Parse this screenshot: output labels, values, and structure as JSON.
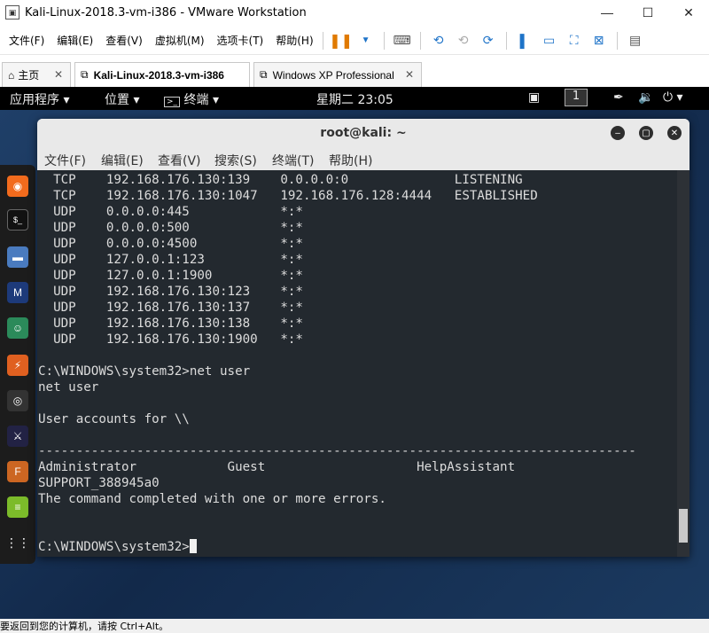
{
  "window": {
    "title": "Kali-Linux-2018.3-vm-i386 - VMware Workstation"
  },
  "menu": [
    "文件(F)",
    "编辑(E)",
    "查看(V)",
    "虚拟机(M)",
    "选项卡(T)",
    "帮助(H)"
  ],
  "tabs": [
    {
      "label": "主页"
    },
    {
      "label": "Kali-Linux-2018.3-vm-i386"
    },
    {
      "label": "Windows XP Professional"
    }
  ],
  "gnome": {
    "apps": "应用程序",
    "places": "位置",
    "terminal": "终端",
    "clock": "星期二 23:05",
    "workspace": "1"
  },
  "terminal": {
    "title": "root@kali: ~",
    "menu": [
      "文件(F)",
      "编辑(E)",
      "查看(V)",
      "搜索(S)",
      "终端(T)",
      "帮助(H)"
    ],
    "lines": [
      "  TCP    192.168.176.130:139    0.0.0.0:0              LISTENING",
      "  TCP    192.168.176.130:1047   192.168.176.128:4444   ESTABLISHED",
      "  UDP    0.0.0.0:445            *:*",
      "  UDP    0.0.0.0:500            *:*",
      "  UDP    0.0.0.0:4500           *:*",
      "  UDP    127.0.0.1:123          *:*",
      "  UDP    127.0.0.1:1900         *:*",
      "  UDP    192.168.176.130:123    *:*",
      "  UDP    192.168.176.130:137    *:*",
      "  UDP    192.168.176.130:138    *:*",
      "  UDP    192.168.176.130:1900   *:*",
      "",
      "C:\\WINDOWS\\system32>net user",
      "net user",
      "",
      "User accounts for \\\\",
      "",
      "-------------------------------------------------------------------------------",
      "Administrator            Guest                    HelpAssistant",
      "SUPPORT_388945a0",
      "The command completed with one or more errors.",
      "",
      ""
    ],
    "prompt": "C:\\WINDOWS\\system32>"
  },
  "status": {
    "text": "要返回到您的计算机，请按 Ctrl+Alt。"
  }
}
